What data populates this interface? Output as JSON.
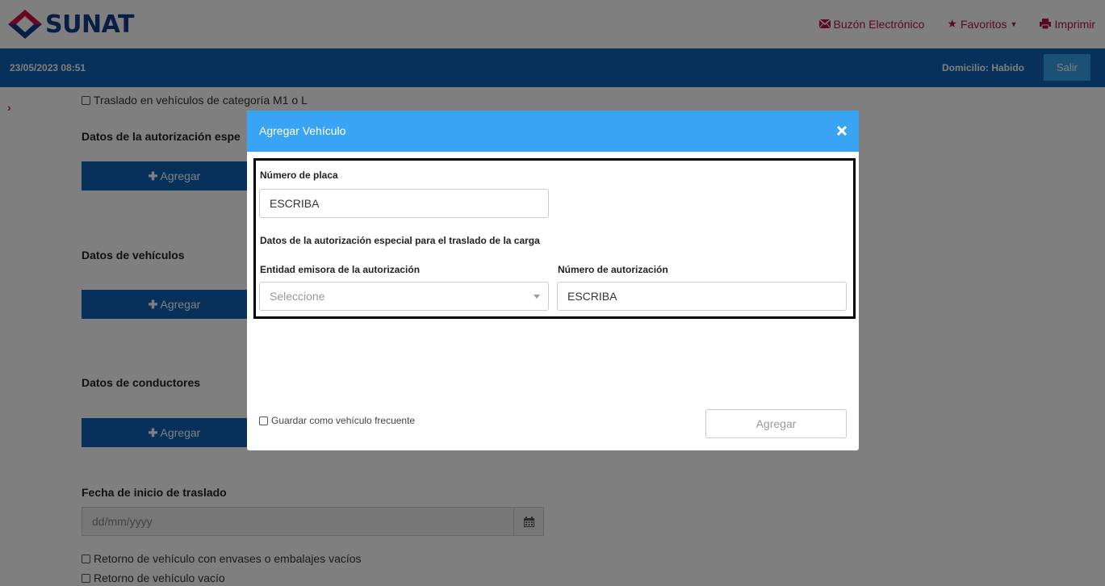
{
  "header": {
    "logo_text": "SUNAT",
    "links": [
      {
        "icon": "envelope-icon",
        "label": "Buzón Electrónico"
      },
      {
        "icon": "star-icon",
        "label": "Favoritos"
      },
      {
        "icon": "printer-icon",
        "label": "Imprimir"
      }
    ],
    "accent_color": "#b3104b"
  },
  "bluebar": {
    "datetime": "23/05/2023 08:51",
    "domicilio": "Domicilio: Habido",
    "salir_label": "Salir",
    "color": "#0e63b6"
  },
  "page": {
    "checkbox_top": "Traslado en vehículos de categoría M1 o L",
    "section_autorizacion": "Datos de la autorización espe",
    "section_vehiculos": "Datos de vehículos",
    "section_conductores": "Datos de conductores",
    "add_label": "Agregar",
    "fecha_label": "Fecha de inicio de traslado",
    "fecha_placeholder": "dd/mm/yyyy",
    "checkbox_retorno_envases": "Retorno de vehículo con envases o embalajes vacíos",
    "checkbox_retorno_vacio": "Retorno de vehículo vacío"
  },
  "modal": {
    "title": "Agregar Vehículo",
    "placa_label": "Número de placa",
    "placa_value": "ESCRIBA",
    "autorizacion_heading": "Datos de la autorización especial para el traslado de la carga",
    "entidad_label": "Entidad emisora de la autorización",
    "entidad_value": "Seleccione",
    "numero_aut_label": "Número de autorización",
    "numero_aut_value": "ESCRIBA",
    "frecuente_label": "Guardar como vehículo frecuente",
    "agregar_label": "Agregar",
    "header_color": "#3aa4f4"
  }
}
